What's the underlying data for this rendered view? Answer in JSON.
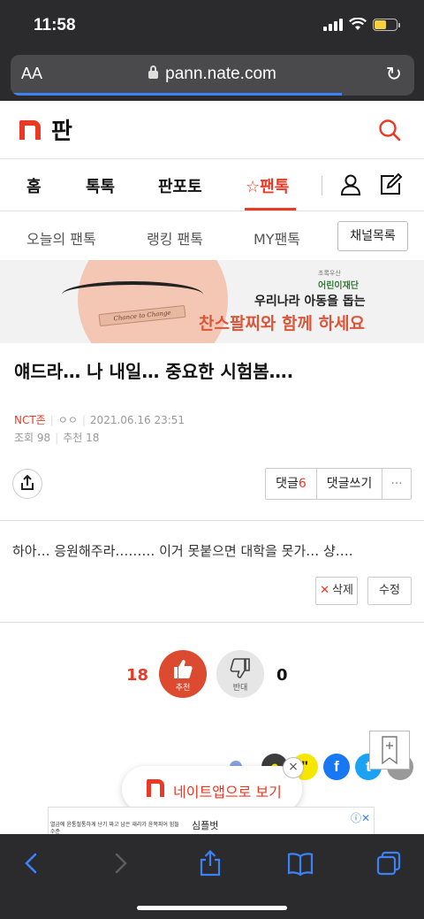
{
  "status": {
    "time": "11:58"
  },
  "browser": {
    "aa": "AA",
    "url": "pann.nate.com",
    "toolbar_icons": [
      "back-arrow-icon",
      "forward-arrow-icon",
      "share-icon",
      "bookmarks-icon",
      "tabs-icon"
    ]
  },
  "header": {
    "logo_text": "판",
    "search_icon": "search-icon"
  },
  "main_nav": {
    "items": [
      "홈",
      "톡톡",
      "판포토",
      "☆팬톡"
    ],
    "active": "☆팬톡"
  },
  "sub_nav": {
    "items": [
      "오늘의 팬톡",
      "랭킹 팬톡",
      "MY팬톡"
    ],
    "channel_button": "채널목록"
  },
  "ad": {
    "org_small": "초록우산",
    "org": "어린이재단",
    "line1": "우리나라 아동을 돕는",
    "line2": "찬스팔찌와 함께 하세요",
    "bracelet_text": "Chance to Change"
  },
  "post": {
    "title": "얘드라… 나 내일… 중요한 시험봄….",
    "category": "NCT존",
    "author": "ㅇㅇ",
    "date": "2021.06.16 23:51",
    "views_label": "조회",
    "views": "98",
    "recommend_label": "추천",
    "recommend": "18",
    "body": "하아… 응원해주라……… 이거 못붙으면 대학을 못가… 샹…."
  },
  "actions": {
    "comments_label": "댓글",
    "comments_count": "6",
    "write_comment": "댓글쓰기",
    "more": "···",
    "delete": "삭제",
    "edit": "수정"
  },
  "votes": {
    "up_count": "18",
    "up_label": "추천",
    "down_label": "반대",
    "down_count": "0"
  },
  "promo": {
    "text": "네이트앱으로 보기",
    "close": "×"
  },
  "bottom_ad": {
    "small_text": "열금에 윤통철통하게 난기 짜고 남은 재리가 윤쪽피어 힘들수준",
    "title": "심플벗",
    "info": "ⓘ✕"
  },
  "colors": {
    "brand_red": "#ea3a26",
    "browser_dark": "#2b2b2e",
    "ios_blue": "#3b82f6"
  }
}
